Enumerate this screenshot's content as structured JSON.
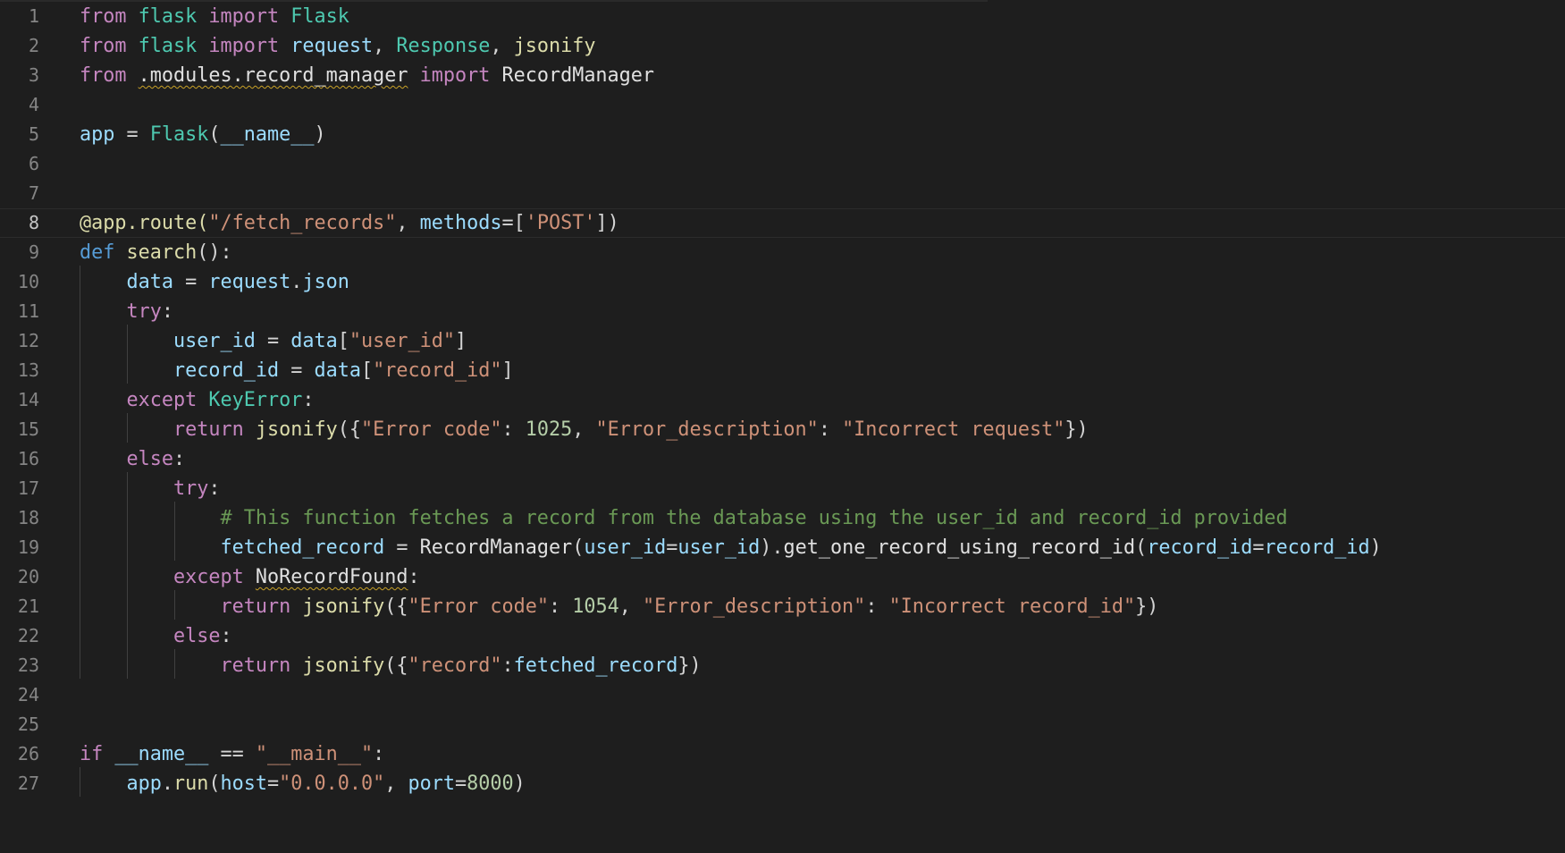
{
  "editor": {
    "language": "python",
    "theme_colors": {
      "background": "#1e1e1e",
      "keyword_control": "#c586c0",
      "keyword_storage": "#569cd6",
      "class": "#4ec9b0",
      "function": "#dcdcaa",
      "variable": "#9cdcfe",
      "string": "#ce9178",
      "number": "#b5cea8",
      "comment": "#6a9955",
      "line_number": "#858585",
      "warning_squiggle": "#c9a227"
    },
    "current_line": 8,
    "line_numbers": [
      "1",
      "2",
      "3",
      "4",
      "5",
      "6",
      "7",
      "8",
      "9",
      "10",
      "11",
      "12",
      "13",
      "14",
      "15",
      "16",
      "17",
      "18",
      "19",
      "20",
      "21",
      "22",
      "23",
      "24",
      "25",
      "26",
      "27"
    ],
    "tokens": {
      "l1": [
        "from",
        "flask",
        "import",
        "Flask"
      ],
      "l2": [
        "from",
        "flask",
        "import",
        "request",
        ", ",
        "Response",
        ", ",
        "jsonify"
      ],
      "l3": [
        "from",
        ".modules.record_manager",
        "import",
        "RecordManager"
      ],
      "l5": [
        "app",
        " = ",
        "Flask",
        "(",
        "__name__",
        ")"
      ],
      "l8": [
        "@app.route(",
        "\"/fetch_records\"",
        ", ",
        "methods",
        "=[",
        "'POST'",
        "])"
      ],
      "l9": [
        "def",
        "search",
        "():"
      ],
      "l10": [
        "data",
        " = ",
        "request",
        ".",
        "json"
      ],
      "l11": [
        "try",
        ":"
      ],
      "l12": [
        "user_id",
        " = ",
        "data",
        "[",
        "\"user_id\"",
        "]"
      ],
      "l13": [
        "record_id",
        " = ",
        "data",
        "[",
        "\"record_id\"",
        "]"
      ],
      "l14": [
        "except",
        "KeyError",
        ":"
      ],
      "l15": [
        "return",
        "jsonify",
        "({",
        "\"Error code\"",
        ": ",
        "1025",
        ", ",
        "\"Error_description\"",
        ": ",
        "\"Incorrect request\"",
        "})"
      ],
      "l16": [
        "else",
        ":"
      ],
      "l17": [
        "try",
        ":"
      ],
      "l18": [
        "# This function fetches a record from the database using the user_id and record_id provided"
      ],
      "l19": [
        "fetched_record",
        " = ",
        "RecordManager",
        "(",
        "user_id",
        "=",
        "user_id",
        ").",
        "get_one_record_using_record_id",
        "(",
        "record_id",
        "=",
        "record_id",
        ")"
      ],
      "l20": [
        "except",
        "NoRecordFound",
        ":"
      ],
      "l21": [
        "return",
        "jsonify",
        "({",
        "\"Error code\"",
        ": ",
        "1054",
        ", ",
        "\"Error_description\"",
        ": ",
        "\"Incorrect record_id\"",
        "})"
      ],
      "l22": [
        "else",
        ":"
      ],
      "l23": [
        "return",
        "jsonify",
        "({",
        "\"record\"",
        ":",
        "fetched_record",
        "})"
      ],
      "l26": [
        "if",
        "__name__",
        " == ",
        "\"__main__\"",
        ":"
      ],
      "l27": [
        "app",
        ".",
        "run",
        "(",
        "host",
        "=",
        "\"0.0.0.0\"",
        ", ",
        "port",
        "=",
        "8000",
        ")"
      ]
    }
  }
}
